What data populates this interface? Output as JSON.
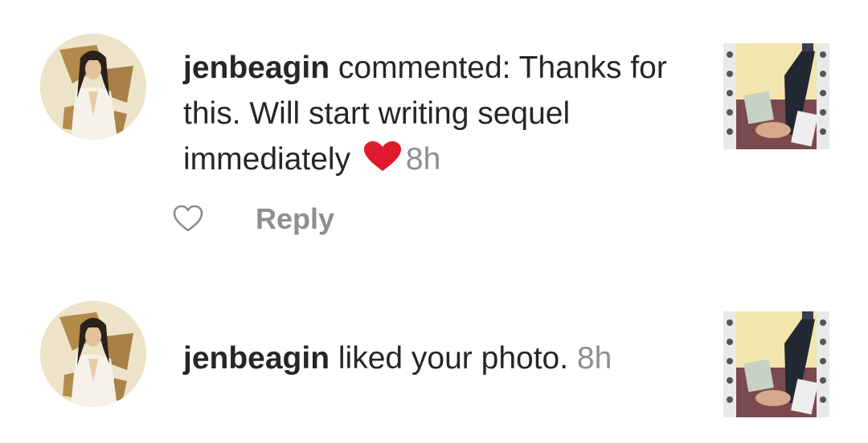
{
  "notifications": [
    {
      "username": "jenbeagin",
      "message": " commented: Thanks for this. Will start writing sequel immediately ",
      "emoji": "red-heart-emoji",
      "time": "8h",
      "like_icon": "heart-outline-icon",
      "reply_label": "Reply"
    },
    {
      "username": "jenbeagin",
      "message": " liked your photo. ",
      "time": "8h"
    }
  ],
  "colors": {
    "text_primary": "#262626",
    "text_secondary": "#8e8e8e",
    "emoji_heart": "#e0192c"
  }
}
